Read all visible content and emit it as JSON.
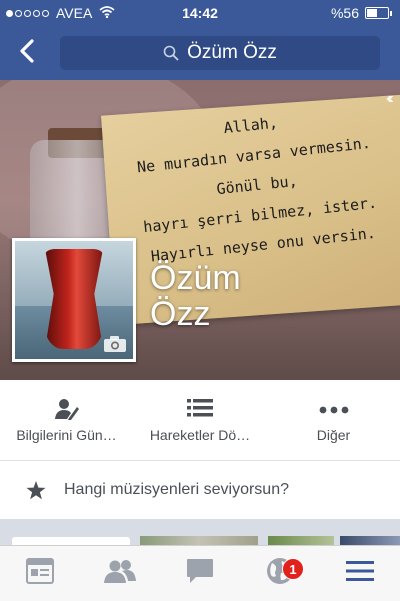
{
  "status_bar": {
    "carrier": "AVEA",
    "time": "14:42",
    "battery_percent": "%56",
    "battery_level": 0.56,
    "signal_bars_filled": 1,
    "signal_bars_total": 5
  },
  "nav": {
    "back_icon": "chevron-left-icon",
    "search_text": "Özüm Özz",
    "search_icon": "search-icon"
  },
  "cover": {
    "note_lines": [
      "Allah,",
      "Ne muradın varsa vermesin.",
      "Gönül bu,",
      "hayrı şerri bilmez, ister.",
      "Hayırlı neyse onu versin."
    ]
  },
  "profile": {
    "name_line1": "Özüm",
    "name_line2": "Özz"
  },
  "actions": [
    {
      "label": "Bilgilerini Gün…",
      "icon": "edit-profile-icon"
    },
    {
      "label": "Hareketler Dö…",
      "icon": "activity-log-icon"
    },
    {
      "label": "Diğer",
      "icon": "more-icon"
    }
  ],
  "composer": {
    "icon": "star-icon",
    "prompt": "Hangi müzisyenleri seviyorsun?"
  },
  "tab_bar": {
    "tabs": [
      {
        "name": "news-feed",
        "icon": "news-feed-icon"
      },
      {
        "name": "friends",
        "icon": "friends-icon"
      },
      {
        "name": "messages",
        "icon": "messages-icon"
      },
      {
        "name": "notifications",
        "icon": "globe-icon",
        "badge": "1"
      },
      {
        "name": "menu",
        "icon": "menu-icon"
      }
    ]
  },
  "colors": {
    "brand": "#3b5998",
    "search_bg": "#2f4a84",
    "active_tab": "#3b5998",
    "badge": "#e0211c",
    "inactive_icon": "#9da3ad"
  }
}
